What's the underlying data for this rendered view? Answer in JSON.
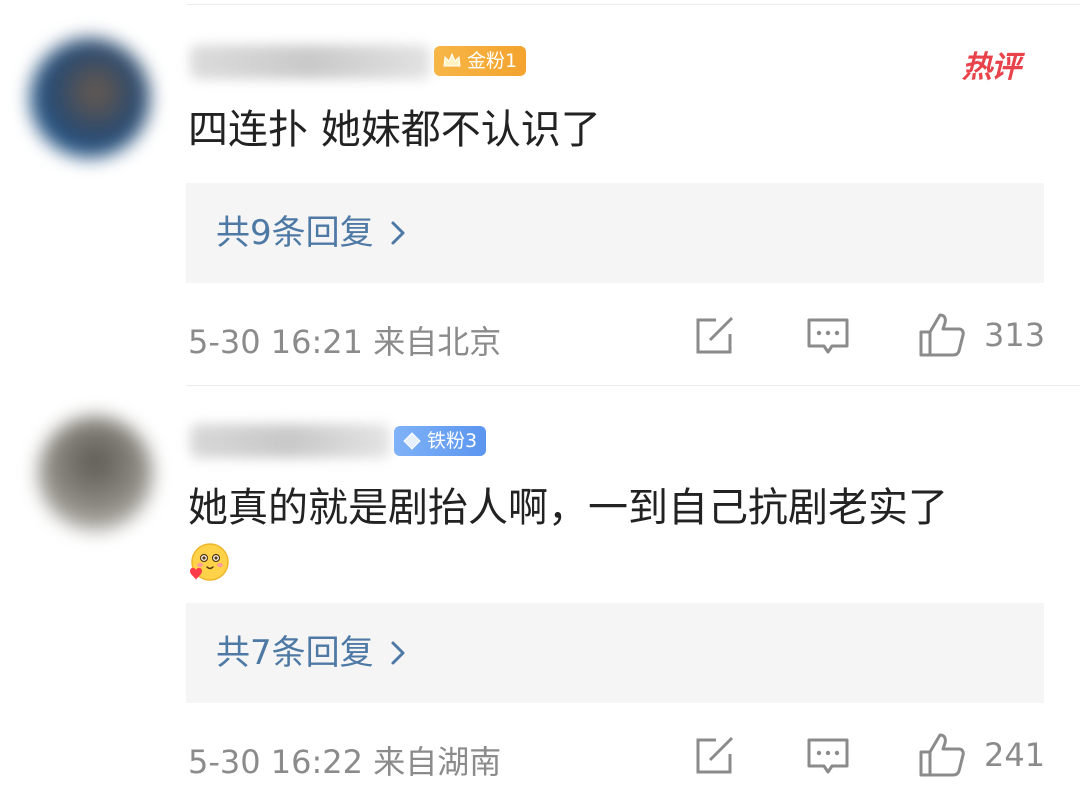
{
  "colors": {
    "link": "#4e79a5",
    "meta": "#8b8b8b",
    "hot_red": "#e8424a",
    "badge_gold": "#f4a32e",
    "badge_iron": "#5b95ef"
  },
  "comments": [
    {
      "badge": "金粉1",
      "badge_icon": "crown-icon",
      "hot_tag": "热评",
      "text": "四连扑 她妹都不认识了",
      "reply_label": "共9条回复",
      "meta": "5-30 16:21 来自北京",
      "likes": "313"
    },
    {
      "badge": "铁粉3",
      "badge_icon": "diamond-icon",
      "text": "她真的就是剧抬人啊，一到自己抗剧老实了",
      "emoji": "blush-heart-emoji",
      "reply_label": "共7条回复",
      "meta": "5-30 16:22 来自湖南",
      "likes": "241"
    }
  ]
}
